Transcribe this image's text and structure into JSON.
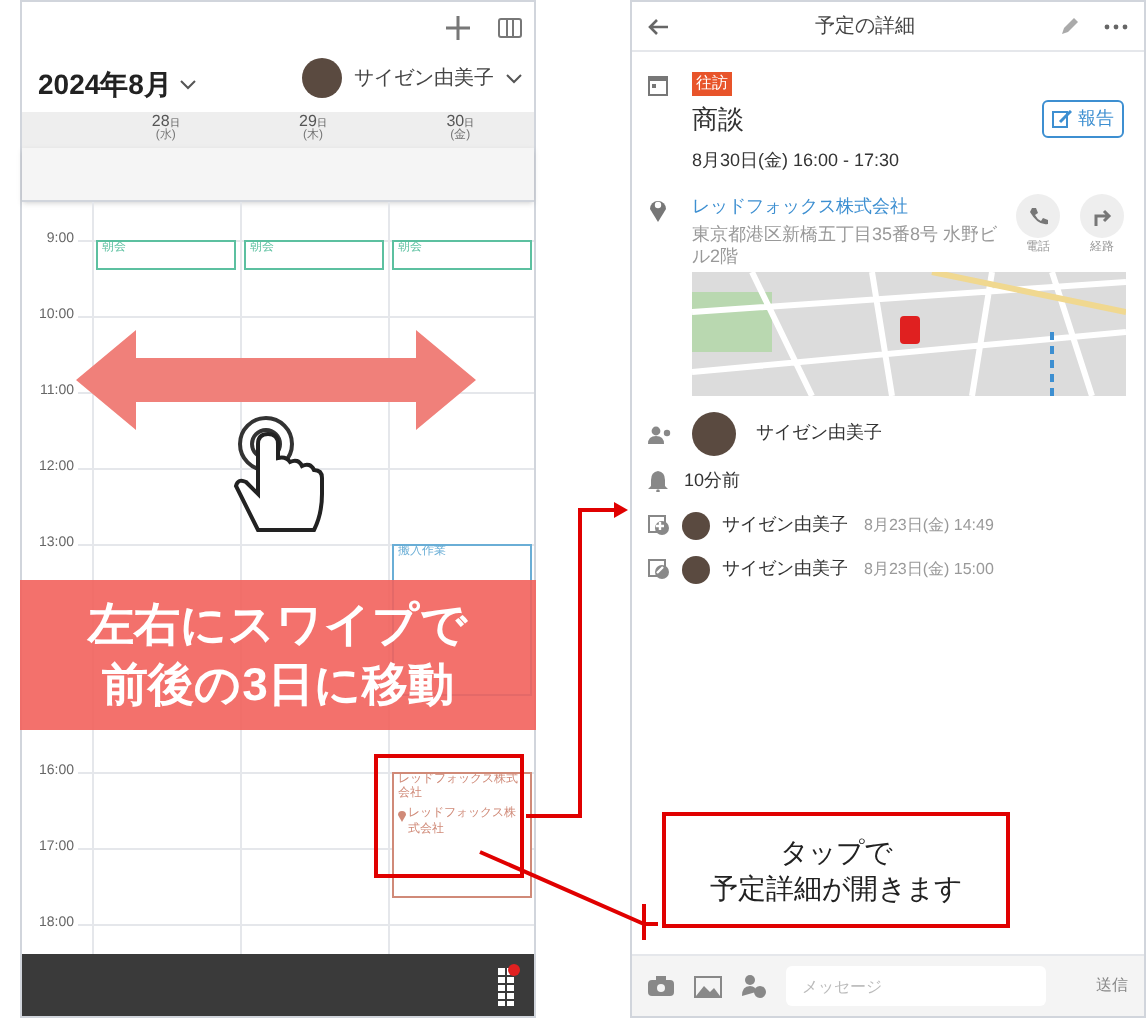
{
  "calendar": {
    "month_label": "2024年8月",
    "user_name": "サイゼン由美子",
    "days": [
      {
        "date": "28",
        "unit": "日",
        "weekday": "(水)",
        "events": [
          {
            "title": "朝会",
            "color": "#5cc0a0"
          }
        ]
      },
      {
        "date": "29",
        "unit": "日",
        "weekday": "(木)",
        "events": [
          {
            "title": "朝会",
            "color": "#5cc0a0"
          }
        ]
      },
      {
        "date": "30",
        "unit": "日",
        "weekday": "(金)",
        "events": [
          {
            "title": "朝会",
            "color": "#5cc0a0"
          },
          {
            "title": "搬入作業",
            "color": "#6aaed6"
          },
          {
            "title": "レッドフォックス株式会社",
            "location": "レッドフォックス株式会社",
            "color": "#d08a78"
          }
        ]
      }
    ],
    "times": [
      "9:00",
      "10:00",
      "11:00",
      "12:00",
      "13:00",
      "16:00",
      "17:00",
      "18:00"
    ]
  },
  "annotations": {
    "swipe_banner": [
      "左右にスワイプで",
      "前後の3日に移動"
    ],
    "tap_callout": [
      "タップで",
      "予定詳細が開きます"
    ]
  },
  "detail": {
    "title": "予定の詳細",
    "tag": "往訪",
    "subject": "商談",
    "report_button": "報告",
    "datetime": "8月30日(金) 16:00 - 17:30",
    "location": "レッドフォックス株式会社",
    "address": "東京都港区新橋五丁目35番8号 水野ビル2階",
    "call_label": "電話",
    "route_label": "経路",
    "attendee": "サイゼン由美子",
    "reminder": "10分前",
    "history": [
      {
        "kind": "created",
        "name": "サイゼン由美子",
        "time": "8月23日(金) 14:49"
      },
      {
        "kind": "edited",
        "name": "サイゼン由美子",
        "time": "8月23日(金) 15:00"
      }
    ],
    "message_placeholder": "メッセージ",
    "send": "送信"
  }
}
